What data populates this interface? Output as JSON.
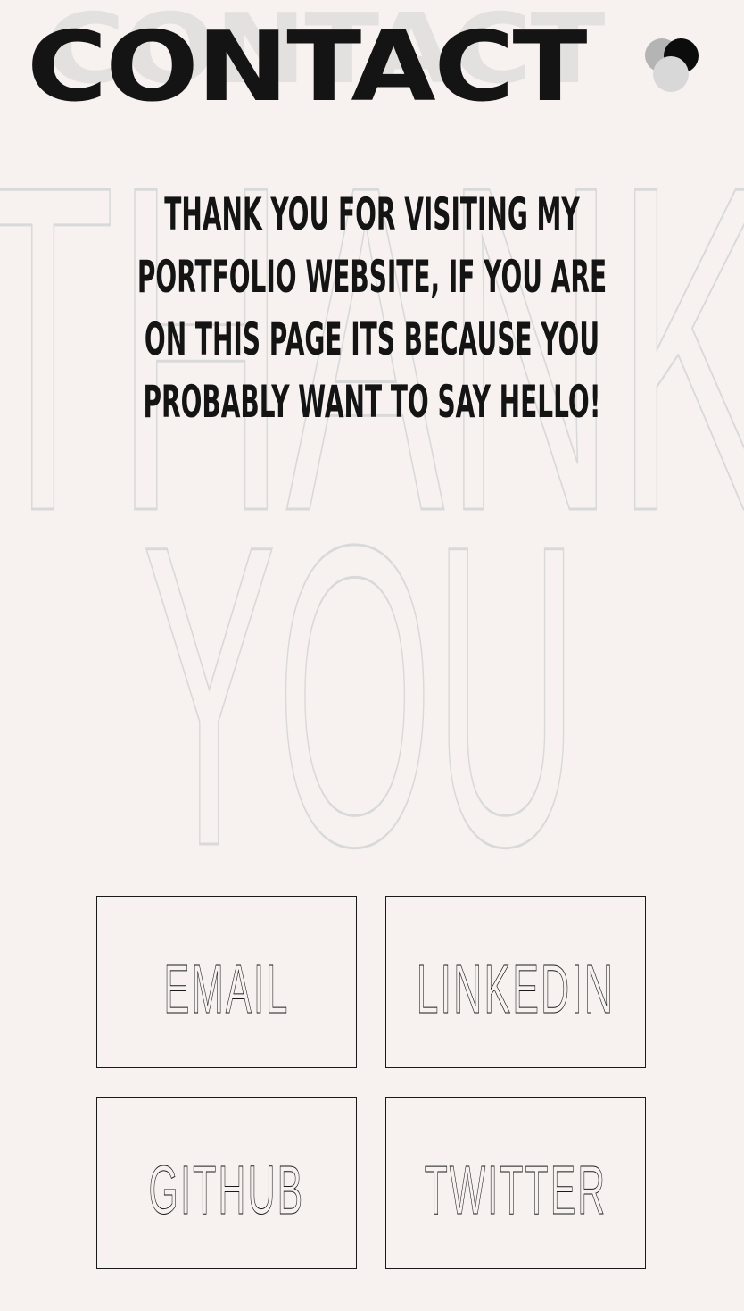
{
  "header": {
    "title": "CONTACT",
    "title_ghost": "CONTACT"
  },
  "theme_toggle": {
    "icon": "theme-dots-icon",
    "colors": [
      "#b4b4b4",
      "#0c0c0c",
      "#d8d8d8"
    ]
  },
  "background_words": {
    "line1": "THANK",
    "line2": "YOU"
  },
  "intro": {
    "text": "THANK YOU FOR VISITING MY PORTFOLIO WEBSITE, IF YOU ARE ON THIS PAGE ITS BECAUSE YOU PROBABLY WANT TO SAY HELLO!"
  },
  "links": {
    "email": "EMAIL",
    "linkedin": "LINKEDIN",
    "github": "GITHUB",
    "twitter": "TWITTER"
  },
  "colors": {
    "background": "#f7f2f0",
    "text": "#141414",
    "outline": "#d9d9d9"
  }
}
